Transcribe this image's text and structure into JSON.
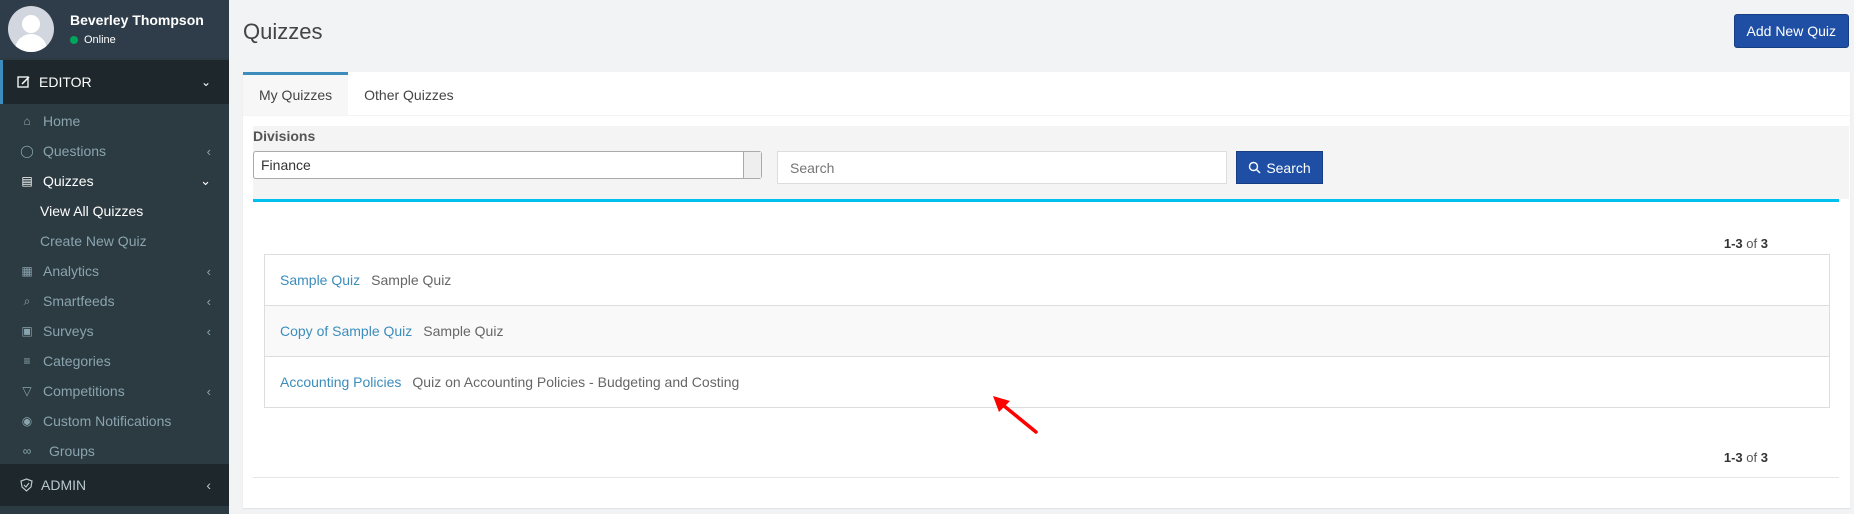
{
  "user": {
    "name": "Beverley Thompson",
    "status": "Online"
  },
  "sidebar": {
    "section_editor": "EDITOR",
    "items": [
      {
        "label": "Home",
        "icon": "home-icon",
        "has_children": false
      },
      {
        "label": "Questions",
        "icon": "comment-icon",
        "has_children": true
      },
      {
        "label": "Quizzes",
        "icon": "quiz-icon",
        "has_children": true,
        "active": true
      },
      {
        "label": "Analytics",
        "icon": "bar-chart-icon",
        "has_children": true
      },
      {
        "label": "Smartfeeds",
        "icon": "feed-icon",
        "has_children": true
      },
      {
        "label": "Surveys",
        "icon": "clipboard-icon",
        "has_children": true
      },
      {
        "label": "Categories",
        "icon": "list-icon",
        "has_children": false
      },
      {
        "label": "Competitions",
        "icon": "trophy-icon",
        "has_children": true
      },
      {
        "label": "Custom Notifications",
        "icon": "bell-icon",
        "has_children": false
      },
      {
        "label": "Groups",
        "icon": "link-icon",
        "has_children": false
      }
    ],
    "quizzes_sub": [
      {
        "label": "View All Quizzes",
        "current": true
      },
      {
        "label": "Create New Quiz",
        "current": false
      }
    ],
    "section_admin": "ADMIN"
  },
  "header": {
    "title": "Quizzes",
    "add_button": "Add New Quiz"
  },
  "tabs": [
    {
      "label": "My Quizzes",
      "active": true
    },
    {
      "label": "Other Quizzes",
      "active": false
    }
  ],
  "filters": {
    "divisions_label": "Divisions",
    "division_selected": "Finance",
    "search_placeholder": "Search",
    "search_button": "Search"
  },
  "pagination": {
    "range": "1-3",
    "of": "of",
    "total": "3"
  },
  "quizzes": [
    {
      "title": "Sample Quiz",
      "description": "Sample Quiz"
    },
    {
      "title": "Copy of Sample Quiz",
      "description": "Sample Quiz"
    },
    {
      "title": "Accounting Policies",
      "description": "Quiz on Accounting Policies - Budgeting and Costing"
    }
  ],
  "colors": {
    "sidebar_bg": "#2c3b41",
    "primary_button": "#1f4fa4",
    "link": "#3c8dbc",
    "accent_rule": "#00c0ef",
    "annotation": "#ff0000"
  }
}
